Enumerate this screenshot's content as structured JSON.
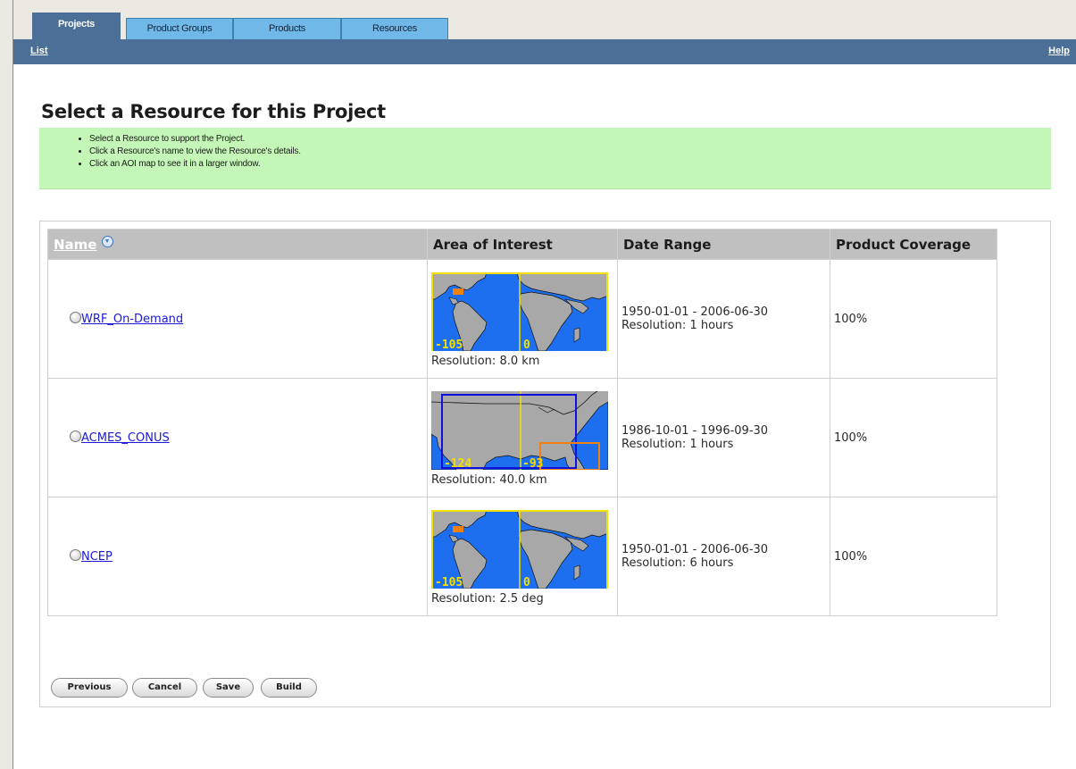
{
  "tabs": [
    {
      "label": "Projects"
    },
    {
      "label": "Product Groups"
    },
    {
      "label": "Products"
    },
    {
      "label": "Resources"
    }
  ],
  "nav": {
    "left_link": "List",
    "right_link": "Help"
  },
  "page_title": "Select a Resource for this Project",
  "instructions": [
    "Select a Resource to support the Project.",
    "Click a Resource's name to view the Resource's details.",
    "Click an AOI map to see it in a larger window."
  ],
  "table": {
    "headers": {
      "name": "Name",
      "sort_icon": "sort-descending-icon",
      "aoi": "Area of Interest",
      "date_range": "Date Range",
      "coverage": "Product Coverage"
    },
    "rows": [
      {
        "name": "WRF_On-Demand",
        "map_left": "-105",
        "map_right": "0",
        "aoi_resolution": "Resolution: 8.0 km",
        "date_range": "1950-01-01 - 2006-06-30",
        "time_resolution": "Resolution: 1 hours",
        "coverage": "100%"
      },
      {
        "name": "ACMES_CONUS",
        "map_left": "-124",
        "map_right": "-93",
        "aoi_resolution": "Resolution: 40.0 km",
        "date_range": "1986-10-01 - 1996-09-30",
        "time_resolution": "Resolution: 1 hours",
        "coverage": "100%"
      },
      {
        "name": "NCEP",
        "map_left": "-105",
        "map_right": "0",
        "aoi_resolution": "Resolution: 2.5 deg",
        "date_range": "1950-01-01 - 2006-06-30",
        "time_resolution": "Resolution: 6 hours",
        "coverage": "100%"
      }
    ]
  },
  "buttons": {
    "previous": "Previous",
    "cancel": "Cancel",
    "save": "Save",
    "build": "Build"
  },
  "colors": {
    "tab_active": "#4b6f96",
    "tab_inactive": "#6fb8e8",
    "help_background": "#c4f7b7",
    "header_background": "#c0c0c0",
    "link": "#1a1ad6",
    "map_ocean": "#1e6ff0",
    "map_land": "#a8a8a8",
    "map_axis": "#f2e100",
    "aoi_blue": "#1010e0",
    "aoi_orange": "#f08010"
  }
}
